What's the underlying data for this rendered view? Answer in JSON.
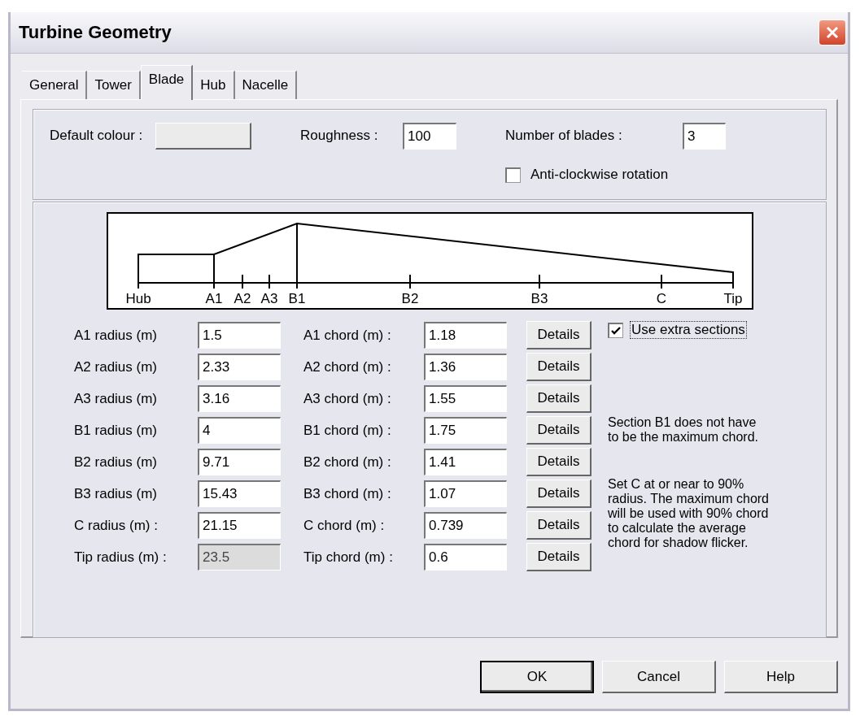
{
  "window": {
    "title": "Turbine Geometry"
  },
  "tabs": [
    {
      "label": "General",
      "selected": false
    },
    {
      "label": "Tower",
      "selected": false
    },
    {
      "label": "Blade",
      "selected": true
    },
    {
      "label": "Hub",
      "selected": false
    },
    {
      "label": "Nacelle",
      "selected": false
    }
  ],
  "blade": {
    "default_colour_label": "Default colour :",
    "roughness": {
      "label": "Roughness :",
      "value": "100"
    },
    "number_of_blades": {
      "label": "Number of blades :",
      "value": "3"
    },
    "anti_clockwise": {
      "label": "Anti-clockwise  rotation",
      "checked": false
    }
  },
  "diagram": {
    "labels": [
      "Hub",
      "A1",
      "A2",
      "A3",
      "B1",
      "B2",
      "B3",
      "C",
      "Tip"
    ]
  },
  "sections": [
    {
      "radius_label": "A1 radius (m)",
      "radius": "1.5",
      "disabled": false,
      "chord_label": "A1 chord (m) :",
      "chord": "1.18",
      "button": "Details"
    },
    {
      "radius_label": "A2 radius (m)",
      "radius": "2.33",
      "disabled": false,
      "chord_label": "A2 chord (m) :",
      "chord": "1.36",
      "button": "Details"
    },
    {
      "radius_label": "A3 radius (m)",
      "radius": "3.16",
      "disabled": false,
      "chord_label": "A3 chord (m) :",
      "chord": "1.55",
      "button": "Details"
    },
    {
      "radius_label": "B1 radius (m)",
      "radius": "4",
      "disabled": false,
      "chord_label": "B1 chord (m) :",
      "chord": "1.75",
      "button": "Details"
    },
    {
      "radius_label": "B2 radius (m)",
      "radius": "9.71",
      "disabled": false,
      "chord_label": "B2 chord (m) :",
      "chord": "1.41",
      "button": "Details"
    },
    {
      "radius_label": "B3 radius (m)",
      "radius": "15.43",
      "disabled": false,
      "chord_label": "B3 chord (m) :",
      "chord": "1.07",
      "button": "Details"
    },
    {
      "radius_label": "C radius (m) :",
      "radius": "21.15",
      "disabled": false,
      "chord_label": "C chord (m) :",
      "chord": "0.739",
      "button": "Details"
    },
    {
      "radius_label": "Tip radius (m) :",
      "radius": "23.5",
      "disabled": true,
      "chord_label": "Tip chord (m) :",
      "chord": "0.6",
      "button": "Details"
    }
  ],
  "use_extra_sections": {
    "label": "Use extra sections",
    "checked": true
  },
  "notes": [
    "Section B1 does not have to be the maximum chord.",
    "Set C at or near to 90% radius. The maximum chord will be used with 90% chord to calculate the average chord for shadow flicker."
  ],
  "buttons": [
    {
      "label": "OK",
      "default": true
    },
    {
      "label": "Cancel",
      "default": false
    },
    {
      "label": "Help",
      "default": false
    }
  ]
}
